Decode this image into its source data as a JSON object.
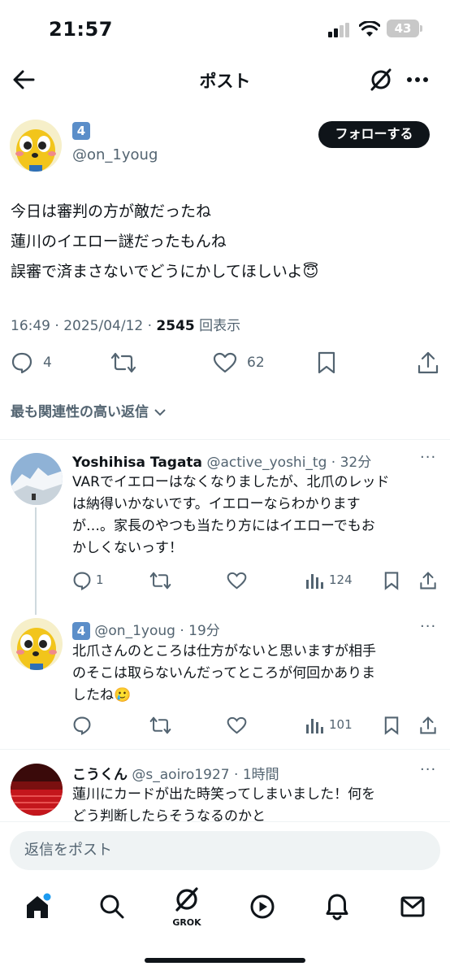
{
  "status_bar": {
    "time": "21:57",
    "battery": "43"
  },
  "topbar": {
    "title": "ポスト"
  },
  "post": {
    "author_badge": "4",
    "handle": "@on_1youg",
    "follow_label": "フォローする",
    "lines": [
      "今日は審判の方が敵だったね",
      "蓮川のイエロー謎だったもんね",
      "誤審で済まさないでどうにかしてほしいよ"
    ],
    "emoji": "😇",
    "time": "16:49",
    "date": "2025/04/12",
    "views": "2545",
    "views_label": "回表示",
    "replies": "4",
    "likes": "62"
  },
  "sort_label": "最も関連性の高い返信",
  "replies": [
    {
      "name": "Yoshihisa Tagata",
      "handle": "@active_yoshi_tg",
      "time": "32分",
      "lines": [
        "VARでイエローはなくなりましたが、北爪のレッド",
        "は納得いかないです。イエローならわかります",
        "が…。家長のやつも当たり方にはイエローでもお",
        "かしくないっす！"
      ],
      "replies": "1",
      "views": "124"
    },
    {
      "badge": "4",
      "handle": "@on_1youg",
      "time": "19分",
      "lines": [
        "北爪さんのところは仕方がないと思いますが相手",
        "のそこは取らないんだってところが何回かありま",
        "したね"
      ],
      "emoji": "🥲",
      "views": "101"
    },
    {
      "name": "こうくん",
      "handle": "@s_aoiro1927",
      "time": "1時間",
      "lines": [
        "蓮川にカードが出た時笑ってしまいました！何を",
        "どう判断したらそうなるのかと"
      ]
    }
  ],
  "reply_placeholder": "返信をポスト",
  "nav": {
    "grok_label": "GROK"
  },
  "colors": {
    "accent": "#1d9bf0",
    "text": "#0f1419",
    "muted": "#536471",
    "badge": "#5b8ec9"
  }
}
